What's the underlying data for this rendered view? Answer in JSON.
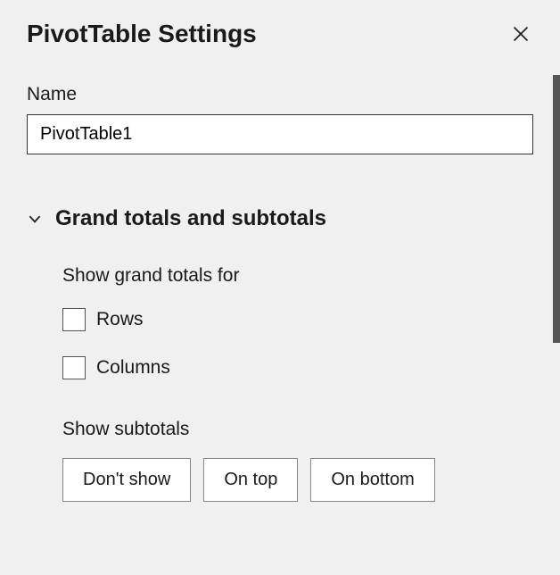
{
  "header": {
    "title": "PivotTable Settings"
  },
  "name": {
    "label": "Name",
    "value": "PivotTable1"
  },
  "section": {
    "title": "Grand totals and subtotals",
    "grandTotals": {
      "heading": "Show grand totals for",
      "rows": {
        "label": "Rows",
        "checked": false
      },
      "columns": {
        "label": "Columns",
        "checked": false
      }
    },
    "subtotals": {
      "heading": "Show subtotals",
      "options": [
        "Don't show",
        "On top",
        "On bottom"
      ]
    }
  }
}
